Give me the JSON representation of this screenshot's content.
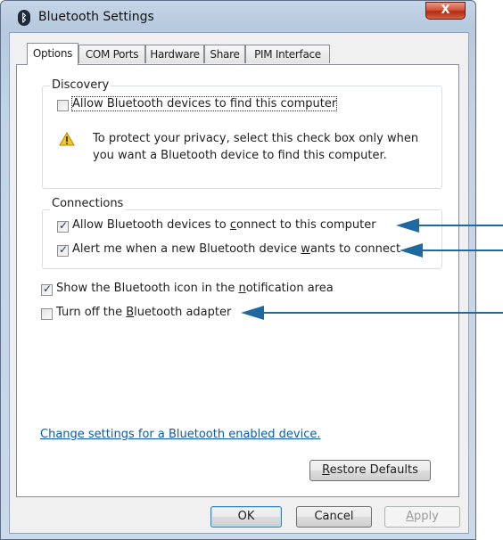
{
  "window": {
    "title": "Bluetooth Settings",
    "close_label": "X"
  },
  "tabs": [
    {
      "label": "Options",
      "active": true
    },
    {
      "label": "COM Ports",
      "active": false
    },
    {
      "label": "Hardware",
      "active": false
    },
    {
      "label": "Share",
      "active": false
    },
    {
      "label": "PIM Interface",
      "active": false
    }
  ],
  "discovery": {
    "label": "Discovery",
    "allow_find": {
      "label": "Allow Bluetooth devices to find this computer",
      "checked": false
    },
    "warning_line1": "To protect your privacy, select this check box only when",
    "warning_line2": "you want a Bluetooth device to find this computer."
  },
  "connections": {
    "label": "Connections",
    "allow_connect": {
      "pre": "Allow Bluetooth devices to ",
      "accel": "c",
      "post": "onnect to this computer",
      "checked": true
    },
    "alert_new": {
      "pre": "Alert me when a new Bluetooth device ",
      "accel": "w",
      "post": "ants to connect",
      "checked": true
    }
  },
  "show_icon": {
    "pre": "Show the Bluetooth icon in the ",
    "accel": "n",
    "post": "otification area",
    "checked": true
  },
  "turn_off": {
    "pre": "Turn off the ",
    "accel": "B",
    "post": "luetooth adapter",
    "checked": false
  },
  "link_text": "Change settings for a Bluetooth enabled device.",
  "buttons": {
    "restore": {
      "accel": "R",
      "rest": "estore Defaults"
    },
    "ok": "OK",
    "cancel": "Cancel",
    "apply": {
      "accel": "A",
      "rest": "pply"
    }
  },
  "colors": {
    "arrow": "#1e6aa0",
    "link": "#0a5ca8"
  }
}
